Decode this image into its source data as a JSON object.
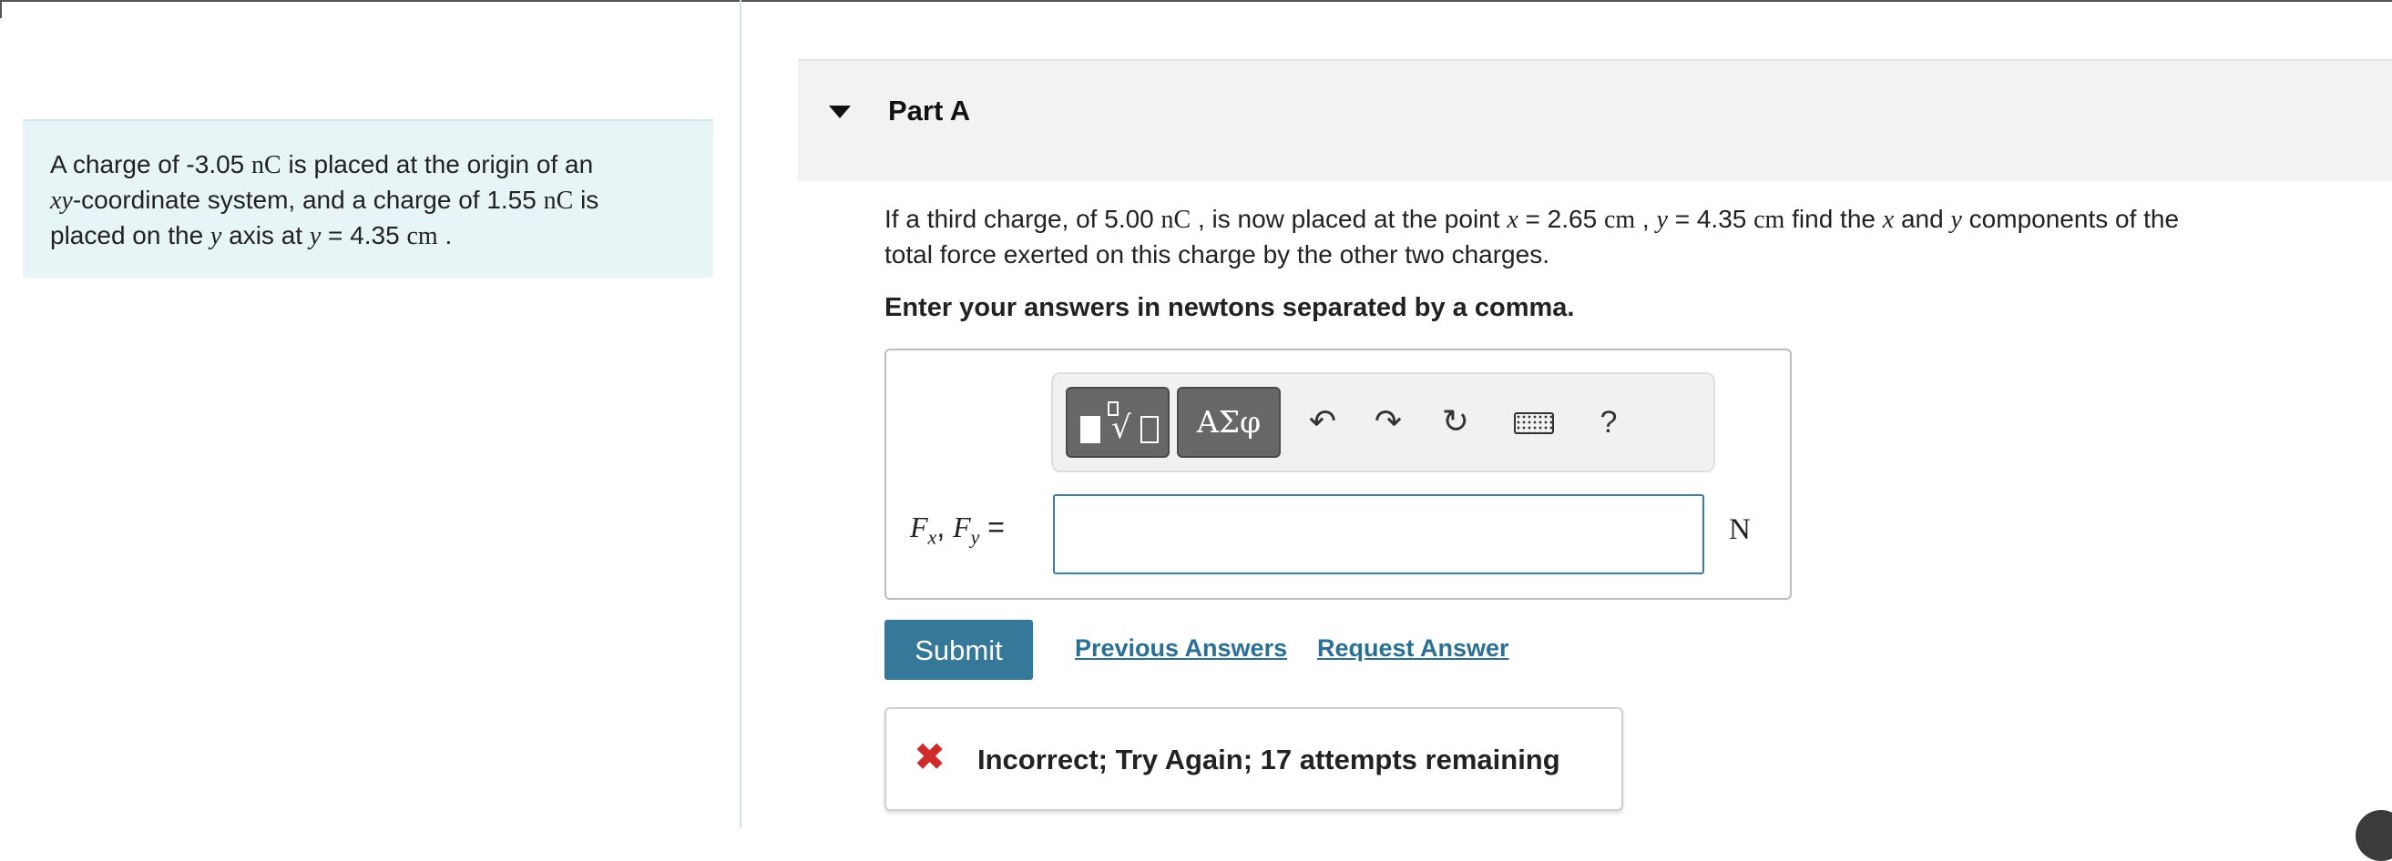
{
  "intro": {
    "l1a": "A charge of -3.05 ",
    "l1u": "nC",
    "l1b": " is placed at the origin of an",
    "l2m": "xy",
    "l2a": "-coordinate system, and a charge of 1.55 ",
    "l2u": "nC",
    "l2b": " is",
    "l3a": "placed on the ",
    "l3m": "y",
    "l3b": " axis at ",
    "l3m2": "y",
    "l3c": " = 4.35 ",
    "l3u": "cm",
    "l3d": " ."
  },
  "part": {
    "title": "Part A"
  },
  "question": {
    "a": "If a third charge, of 5.00 ",
    "u1": "nC",
    "b": " , is now placed at the point ",
    "m1": "x",
    "c": " = 2.65 ",
    "u2": "cm",
    "d": " , ",
    "m2": "y",
    "e": " = 4.35 ",
    "u3": "cm",
    "f": " find the ",
    "m3": "x",
    "g": " and ",
    "m4": "y",
    "h": " components of the",
    "line2": "total force exerted on this charge by the other two charges."
  },
  "instructions": "Enter your answers in newtons separated by a comma.",
  "toolbar": {
    "greek_label": "ΑΣφ",
    "undo_glyph": "↶",
    "redo_glyph": "↷",
    "reset_glyph": "↻",
    "help_label": "?"
  },
  "answer": {
    "f1": "F",
    "s1": "x",
    "sep": ", ",
    "f2": "F",
    "s2": "y",
    "eq": " =",
    "value": "",
    "unit": "N"
  },
  "actions": {
    "submit_label": "Submit",
    "previous_answers_label": "Previous Answers",
    "request_answer_label": "Request Answer"
  },
  "feedback": {
    "text": "Incorrect; Try Again; 17 attempts remaining"
  },
  "icons": {
    "collapse": "caret-down-icon",
    "template": "fraction-radical-icon",
    "undo": "undo-icon",
    "redo": "redo-icon",
    "reset": "reset-icon",
    "keyboard": "keyboard-icon",
    "incorrect": "x-mark-icon"
  },
  "colors": {
    "accent": "#357899",
    "link": "#2a6f95",
    "error": "#d02b2b",
    "intro_bg": "#e8f5f7",
    "header_bg": "#f2f2f2"
  }
}
